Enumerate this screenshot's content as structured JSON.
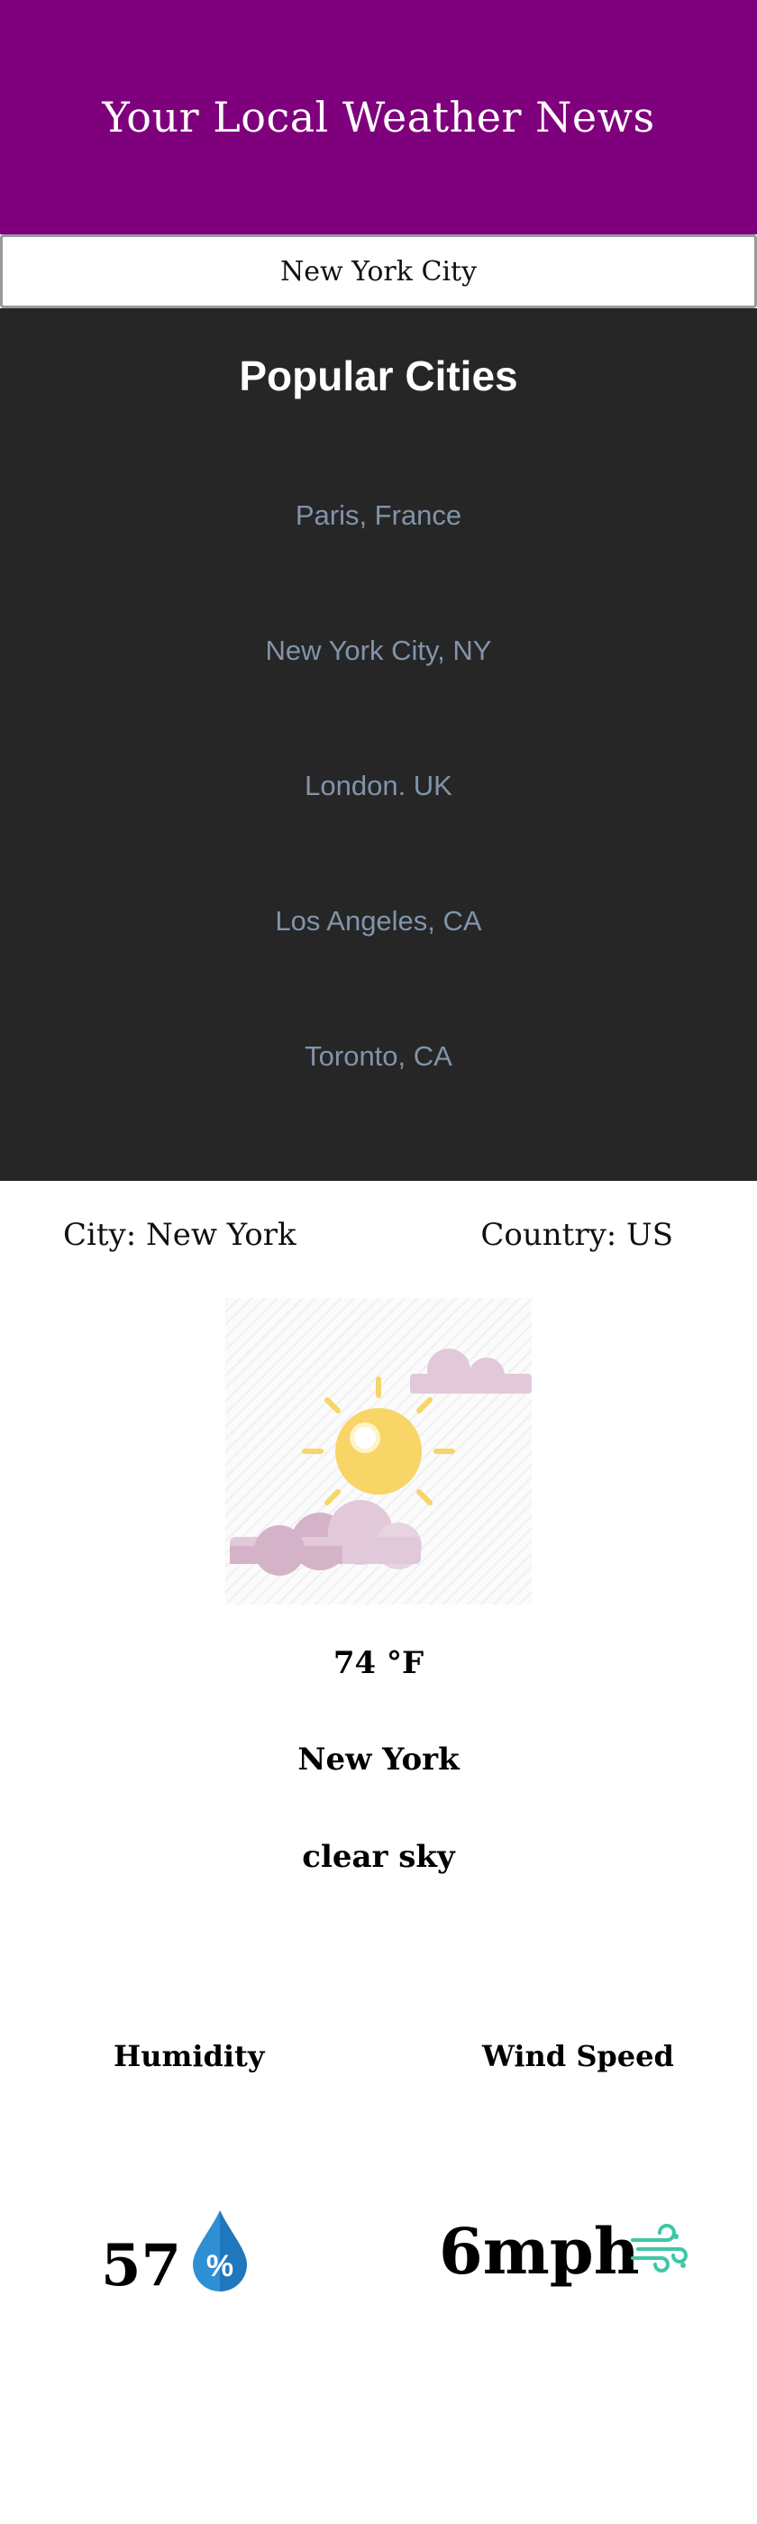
{
  "header": {
    "title": "Your Local Weather News"
  },
  "search": {
    "value": "New York City"
  },
  "popular": {
    "title": "Popular Cities",
    "cities": [
      "Paris, France",
      "New York City, NY",
      "London. UK",
      "Los Angeles, CA",
      "Toronto, CA"
    ]
  },
  "location": {
    "city_text": "City: New York",
    "country_text": "Country: US"
  },
  "weather": {
    "icon": "sun-with-clouds-icon",
    "temperature": "74 °F",
    "city": "New York",
    "description": "clear sky"
  },
  "stats": {
    "humidity": {
      "label": "Humidity",
      "value": "57",
      "icon": "humidity-drop-icon"
    },
    "wind": {
      "label": "Wind Speed",
      "value": "6mph",
      "icon": "wind-icon"
    }
  },
  "colors": {
    "header_bg": "#7f007c",
    "popular_bg": "#262626",
    "city_link": "#8194aa",
    "sun": "#f7d567",
    "cloud": "#d9b8cf",
    "drop": "#2f8fd4",
    "wind": "#3fc7a6"
  }
}
